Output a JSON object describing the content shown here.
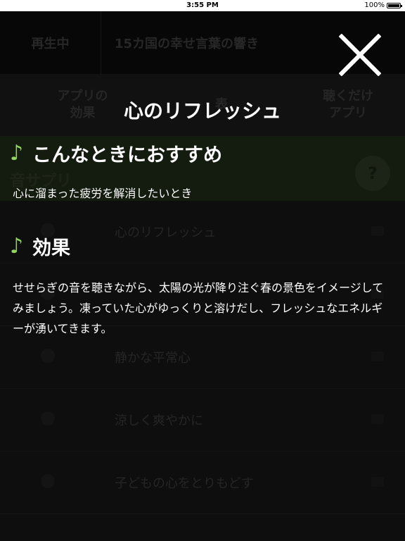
{
  "status_bar": {
    "time": "3:55 PM",
    "battery": "100%"
  },
  "background": {
    "header": {
      "now_playing": "再生中",
      "title": "15カ国の幸せ言葉の響き"
    },
    "tabs": [
      {
        "label": "アプリの\n効果"
      },
      {
        "label": "表"
      },
      {
        "label": "聴くだけ\nアプリ"
      }
    ],
    "category": "音サプリ",
    "help": "?",
    "rows": [
      {
        "label": "心のリフレッシュ"
      },
      {
        "label": ""
      },
      {
        "label": "静かな平常心"
      },
      {
        "label": "涼しく爽やかに"
      },
      {
        "label": "子どもの心をとりもどす"
      }
    ]
  },
  "modal": {
    "title": "心のリフレッシュ",
    "note_icon": "♪",
    "sections": [
      {
        "heading": "こんなときにおすすめ",
        "body": "心に溜まった疲労を解消したいとき"
      },
      {
        "heading": "効果",
        "body": "せせらぎの音を聴きながら、太陽の光が降り注ぐ春の景色をイメージしてみましょう。凍っていた心がゆっくりと溶けだし、フレッシュなエネルギーが湧いてきます。"
      }
    ]
  },
  "colors": {
    "accent_green": "#8fd65a",
    "overlay": "#000000",
    "text": "#ffffff"
  }
}
